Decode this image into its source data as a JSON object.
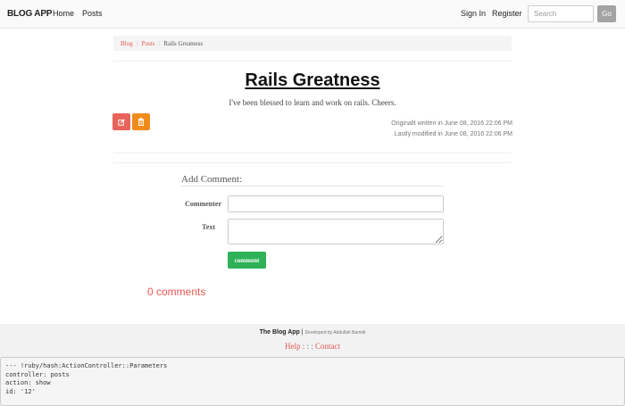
{
  "navbar": {
    "brand": "BLOG APP",
    "home_label": "Home",
    "posts_label": "Posts",
    "signin_label": "Sign In",
    "register_label": "Register",
    "search_placeholder": "Search",
    "search_button_label": "Go"
  },
  "breadcrumb": {
    "items": [
      "Blog",
      "Posts",
      "Rails Greatness"
    ],
    "separator": "/"
  },
  "post": {
    "title": "Rails Greatness",
    "body": "I've been blessed to learn and work on rails. Cheers.",
    "edit_icon": "edit-icon",
    "delete_icon": "trash-icon",
    "written": "Originallt written in June 08, 2016 22:06 PM",
    "modified": "Lastly modified in June 08, 2016 22:06 PM"
  },
  "comment_form": {
    "heading": "Add Comment:",
    "commenter_label": "Commenter",
    "commenter_value": "",
    "text_label": "Text",
    "text_value": "",
    "submit_label": "comment"
  },
  "comments": {
    "count_text": "0 comments"
  },
  "footer": {
    "app_name": "The Blog App",
    "divider": "|",
    "developer": "Developed by Abdullah Bamidi",
    "help_label": "Help",
    "separator": ": : :",
    "contact_label": "Contact"
  },
  "debug": {
    "lines": [
      "--- !ruby/hash:ActionController::Parameters",
      "controller: posts",
      "action: show",
      "id: '12'"
    ]
  },
  "colors": {
    "accent": "#e4574f",
    "edit_button": "#e8635b",
    "delete_button": "#f08c1c",
    "comment_button": "#2fb257"
  }
}
